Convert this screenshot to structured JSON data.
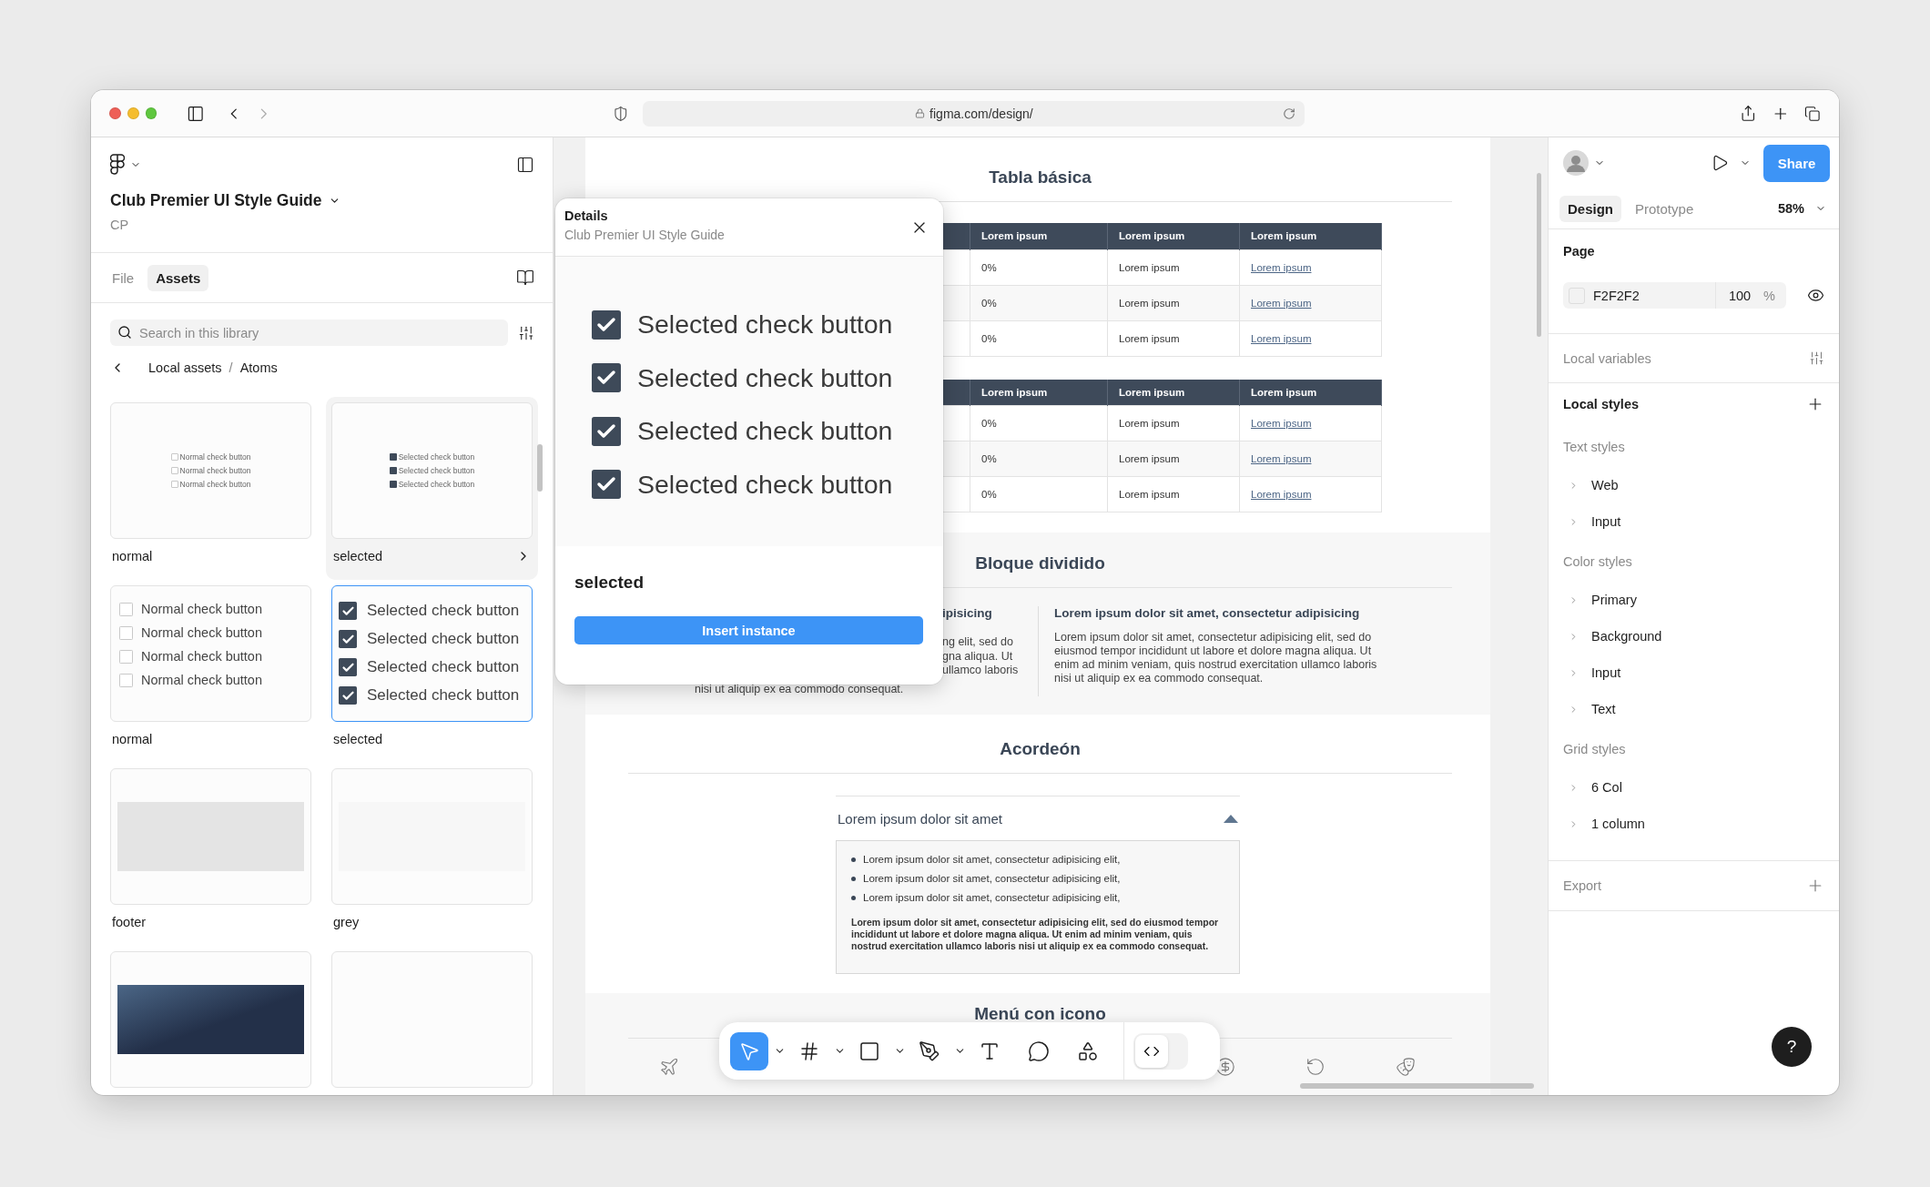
{
  "browser": {
    "url": "figma.com/design/"
  },
  "assets_panel": {
    "file_title": "Club Premier UI Style Guide",
    "team": "CP",
    "tabs": [
      {
        "label": "File",
        "selected": false
      },
      {
        "label": "Assets",
        "selected": true
      }
    ],
    "search": {
      "placeholder": "Search in this library"
    },
    "breadcrumb": [
      "Local assets",
      "Atoms"
    ],
    "breadcrumb_separator": "/",
    "components": [
      {
        "kind": "thumb",
        "name": "normal",
        "checked": false,
        "hovered": false,
        "selected": false,
        "items": [
          "Normal check button",
          "Normal check button",
          "Normal check button"
        ]
      },
      {
        "kind": "thumb",
        "name": "selected",
        "checked": true,
        "hovered": true,
        "selected": false,
        "items": [
          "Selected check button",
          "Selected check button",
          "Selected check button"
        ]
      },
      {
        "kind": "list",
        "name": "normal",
        "checked": false,
        "hovered": false,
        "selected": false,
        "items": [
          "Normal check button",
          "Normal check button",
          "Normal check button",
          "Normal check button"
        ]
      },
      {
        "kind": "list",
        "name": "selected",
        "checked": true,
        "hovered": false,
        "selected": true,
        "items": [
          "Selected check button",
          "Selected check button",
          "Selected check button",
          "Selected check button"
        ]
      },
      {
        "kind": "swatch",
        "name": "footer",
        "color": "#e4e4e4",
        "hovered": false,
        "selected": false
      },
      {
        "kind": "swatch",
        "name": "grey",
        "color": "#f7f7f7",
        "hovered": false,
        "selected": false
      },
      {
        "kind": "gradient",
        "color": "#233049",
        "hovered": false,
        "selected": false
      },
      {
        "kind": "empty",
        "hovered": false,
        "selected": false
      }
    ]
  },
  "canvas": {
    "table_section": {
      "title": "Tabla básica",
      "tables": [
        {
          "columns": [
            {
              "label": "Lorem ipsum",
              "kind": "text"
            },
            {
              "label": "Lorem ipsum",
              "kind": "text"
            },
            {
              "label": "Lorem ipsum",
              "kind": "link"
            }
          ],
          "rows": [
            [
              "0%",
              "Lorem ipsum",
              "Lorem ipsum"
            ],
            [
              "0%",
              "Lorem ipsum",
              "Lorem ipsum"
            ],
            [
              "0%",
              "Lorem ipsum",
              "Lorem ipsum"
            ]
          ]
        },
        {
          "columns": [
            {
              "label": "Lorem ipsum",
              "kind": "text"
            },
            {
              "label": "Lorem ipsum",
              "kind": "text"
            },
            {
              "label": "Lorem ipsum",
              "kind": "link"
            }
          ],
          "rows": [
            [
              "0%",
              "Lorem ipsum",
              "Lorem ipsum"
            ],
            [
              "0%",
              "Lorem ipsum",
              "Lorem ipsum"
            ],
            [
              "0%",
              "Lorem ipsum",
              "Lorem ipsum"
            ]
          ]
        }
      ]
    },
    "split_section": {
      "title": "Bloque dividido",
      "left": {
        "heading": "ipisicing",
        "cut_lines": [
          "ng elit, sed do",
          "gna aliqua. Ut",
          "ullamco laboris"
        ],
        "last_line": "nisi ut aliquip ex ea commodo consequat."
      },
      "right": {
        "heading": "Lorem ipsum dolor sit amet, consectetur adipisicing",
        "body": "Lorem ipsum dolor sit amet, consectetur adipisicing elit, sed do eiusmod tempor incididunt ut labore et dolore magna aliqua. Ut enim ad minim veniam, quis nostrud exercitation ullamco laboris nisi ut aliquip ex ea commodo consequat."
      }
    },
    "accordion_section": {
      "title": "Acordeón",
      "accordion": {
        "header": "Lorem ipsum dolor sit amet",
        "expanded": true,
        "bullets": [
          "Lorem ipsum dolor sit amet, consectetur adipisicing elit,",
          "Lorem ipsum dolor sit amet, consectetur adipisicing elit,",
          "Lorem ipsum dolor sit amet, consectetur adipisicing elit,"
        ],
        "body": "Lorem ipsum dolor sit amet, consectetur adipisicing elit, sed do eiusmod tempor incididunt ut labore et dolore magna aliqua. Ut enim ad minim veniam, quis nostrud exercitation ullamco laboris nisi ut aliquip ex ea commodo consequat."
      }
    },
    "menu_section": {
      "title": "Menú con icono",
      "icons_left": [
        {
          "kind": "plane"
        }
      ],
      "icons_right": [
        {
          "kind": "coin"
        },
        {
          "kind": "refresh"
        },
        {
          "kind": "masks"
        }
      ]
    }
  },
  "details_dialog": {
    "title": "Details",
    "subtitle": "Club Premier UI Style Guide",
    "preview_items": [
      {
        "label": "Selected check button",
        "checked": true
      },
      {
        "label": "Selected check button",
        "checked": true
      },
      {
        "label": "Selected check button",
        "checked": true
      },
      {
        "label": "Selected check button",
        "checked": true
      }
    ],
    "variant": "selected",
    "button": "Insert instance"
  },
  "toolbar": {
    "tools": [
      {
        "kind": "move",
        "selected": true,
        "dropdown": true
      },
      {
        "kind": "frame",
        "selected": false,
        "dropdown": true
      },
      {
        "kind": "shape",
        "selected": false,
        "dropdown": true
      },
      {
        "kind": "pen",
        "selected": false,
        "dropdown": true
      },
      {
        "kind": "text",
        "selected": false,
        "dropdown": false
      },
      {
        "kind": "comment",
        "selected": false,
        "dropdown": false
      },
      {
        "kind": "actions",
        "selected": false,
        "dropdown": false
      }
    ],
    "dev_mode": {
      "on": false
    }
  },
  "properties_panel": {
    "share": "Share",
    "tabs": [
      {
        "label": "Design",
        "selected": true
      },
      {
        "label": "Prototype",
        "selected": false
      }
    ],
    "zoom": "58%",
    "page": {
      "heading": "Page",
      "fill": "F2F2F2",
      "opacity": "100",
      "unit": "%"
    },
    "local_variables": "Local variables",
    "local_styles": {
      "heading": "Local styles",
      "groups": [
        {
          "title": "Text styles",
          "items": [
            "Web",
            "Input"
          ]
        },
        {
          "title": "Color styles",
          "items": [
            "Primary",
            "Background",
            "Input",
            "Text"
          ]
        },
        {
          "title": "Grid styles",
          "items": [
            "6 Col",
            "1 column"
          ]
        }
      ]
    },
    "export": "Export"
  },
  "help": "?"
}
